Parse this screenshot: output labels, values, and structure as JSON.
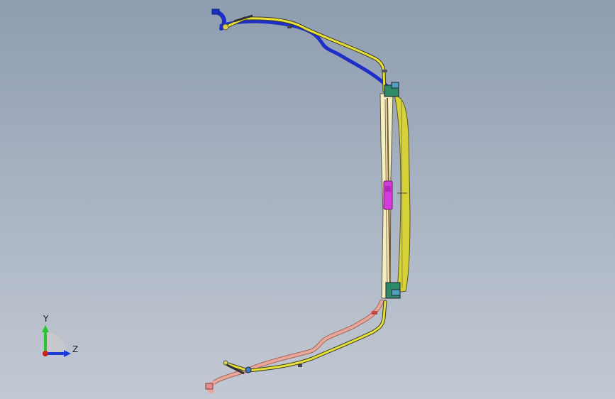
{
  "view": {
    "background_top": "#8f9db1",
    "background_bottom": "#c3c9d3"
  },
  "model": {
    "name": "",
    "parts": [
      {
        "name": "upper-hose",
        "color": "#1f2fc6"
      },
      {
        "name": "upper-harness",
        "color": "#e7e13a"
      },
      {
        "name": "lower-hose",
        "color": "#e7a79a"
      },
      {
        "name": "lower-harness",
        "color": "#e7e13a"
      },
      {
        "name": "radiator-core",
        "color": "#f3efc2"
      },
      {
        "name": "radiator-tank",
        "color": "#d7d23a"
      },
      {
        "name": "connector",
        "color": "#d43bd8"
      }
    ]
  },
  "triad": {
    "y_label": "Y",
    "z_label": "Z",
    "y_color": "#26c52a",
    "z_color": "#1f3bd6",
    "origin_color": "#d01f1f"
  }
}
